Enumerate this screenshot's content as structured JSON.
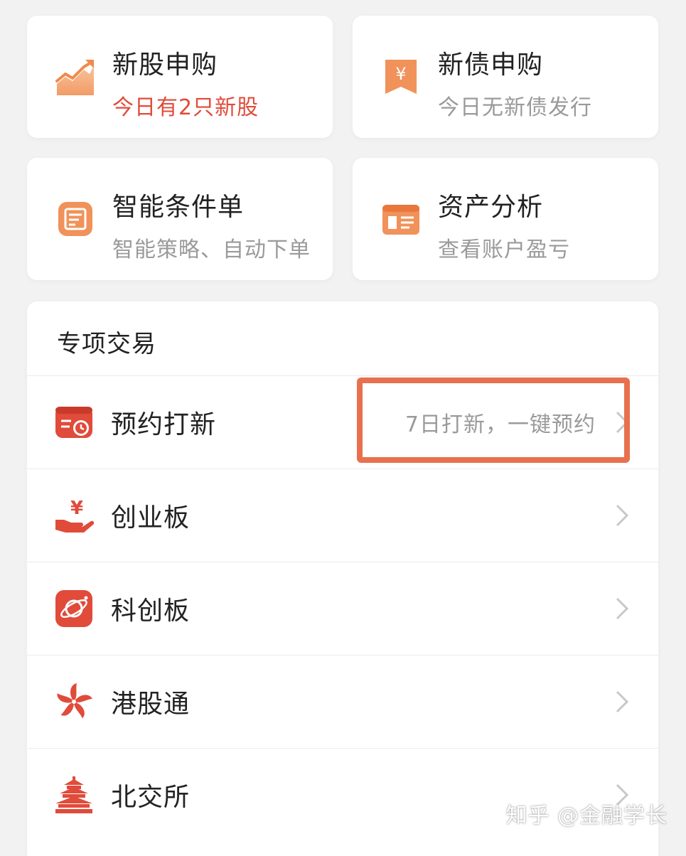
{
  "tiles": [
    {
      "title": "新股申购",
      "subtitle": "今日有2只新股",
      "subtitle_color": "#e04b3a",
      "icon": "rising-chart-icon"
    },
    {
      "title": "新债申购",
      "subtitle": "今日无新债发行",
      "subtitle_color": "#9a9a9a",
      "icon": "yen-bookmark-icon"
    },
    {
      "title": "智能条件单",
      "subtitle": "智能策略、自动下单",
      "subtitle_color": "#9a9a9a",
      "icon": "document-icon"
    },
    {
      "title": "资产分析",
      "subtitle": "查看账户盈亏",
      "subtitle_color": "#9a9a9a",
      "icon": "browser-window-icon"
    }
  ],
  "section": {
    "title": "专项交易",
    "rows": [
      {
        "label": "预约打新",
        "hint": "7日打新，一键预约",
        "icon": "calendar-clock-icon"
      },
      {
        "label": "创业板",
        "hint": "",
        "icon": "hand-yen-icon"
      },
      {
        "label": "科创板",
        "hint": "",
        "icon": "planet-icon"
      },
      {
        "label": "港股通",
        "hint": "",
        "icon": "bauhinia-icon"
      },
      {
        "label": "北交所",
        "hint": "",
        "icon": "temple-icon"
      }
    ]
  },
  "watermark": "知乎 @金融学长",
  "colors": {
    "accent_red": "#e04b3a",
    "icon_orange": "#f08a4b",
    "highlight": "#e8704f",
    "background": "#f2f2f2"
  }
}
